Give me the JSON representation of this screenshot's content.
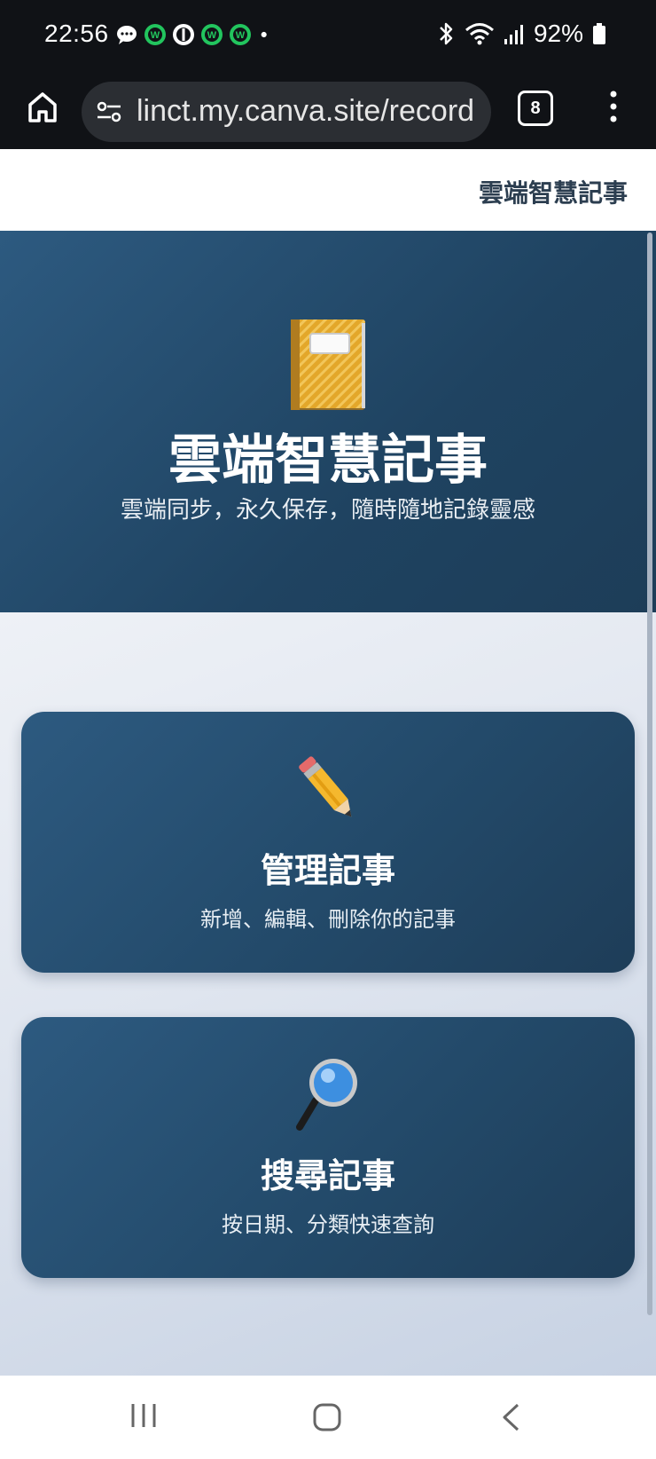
{
  "status_bar": {
    "time": "22:56",
    "battery": "92%",
    "notification_icons": [
      "chat-bubble-icon",
      "line-app-icon",
      "sync-app-icon",
      "line-app-icon",
      "line-app-icon",
      "dot-icon"
    ]
  },
  "browser": {
    "url": "linct.my.canva.site/record",
    "tab_count": "8"
  },
  "site": {
    "header_title": "雲端智慧記事"
  },
  "hero": {
    "title": "雲端智慧記事",
    "subtitle": "雲端同步，永久保存，隨時隨地記錄靈感",
    "icon": "notebook-icon"
  },
  "cards": [
    {
      "title": "管理記事",
      "description": "新增、編輯、刪除你的記事",
      "icon": "pencil-icon"
    },
    {
      "title": "搜尋記事",
      "description": "按日期、分類快速查詢",
      "icon": "magnifier-icon"
    }
  ],
  "colors": {
    "primary": "#2d5a80",
    "primary_dark": "#1d3d58",
    "text_dark": "#2c3e50"
  }
}
